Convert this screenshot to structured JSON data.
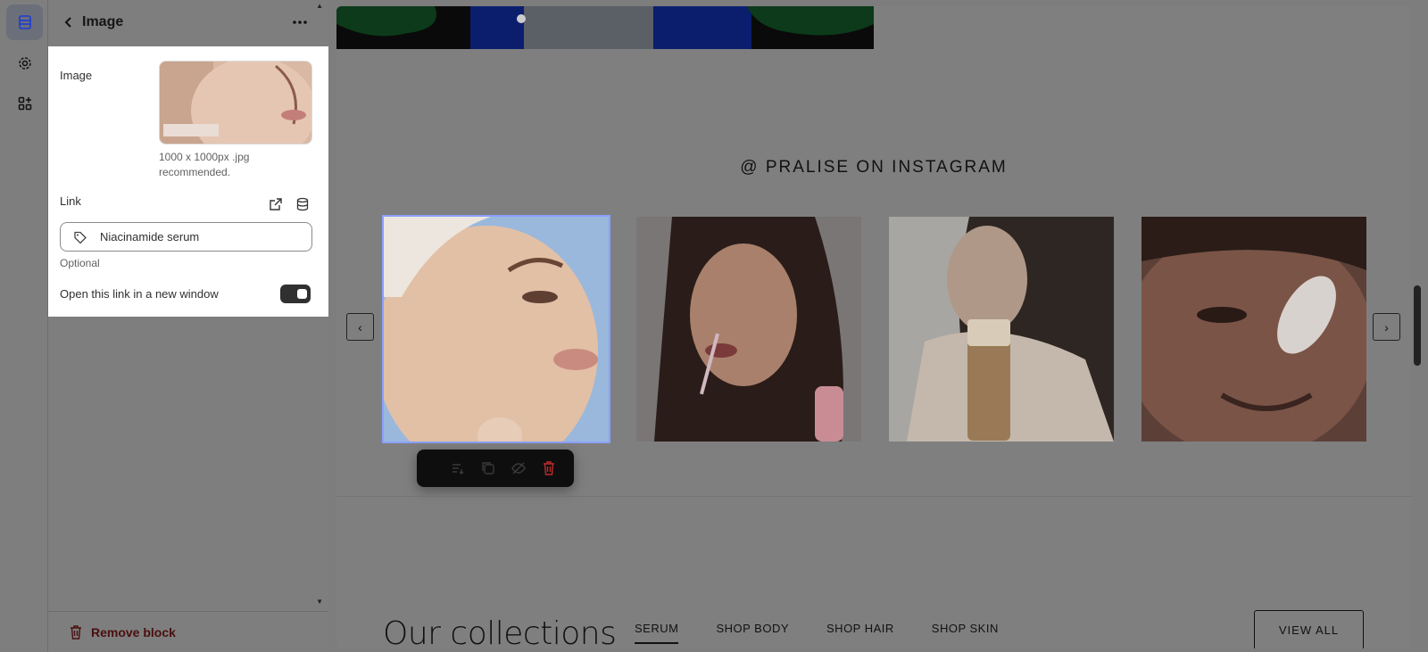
{
  "panel": {
    "title": "Image",
    "image_label": "Image",
    "image_hint": "1000 x 1000px .jpg recommended.",
    "link_label": "Link",
    "link_value": "Niacinamide serum",
    "optional_text": "Optional",
    "new_window_label": "Open this link in a new window",
    "new_window_enabled": true,
    "remove_label": "Remove block"
  },
  "preview": {
    "instagram_title": "@ PRALISE ON INSTAGRAM",
    "prev_arrow": "‹",
    "next_arrow": "›",
    "collections_title": "Our collections",
    "tabs": [
      "SERUM",
      "SHOP BODY",
      "SHOP HAIR",
      "SHOP SKIN"
    ],
    "active_tab": "SERUM",
    "view_all": "VIEW ALL"
  },
  "colors": {
    "accent_selection": "#8aa0ff",
    "remove_text": "#4a0f0f",
    "delete_icon": "#e03030"
  }
}
